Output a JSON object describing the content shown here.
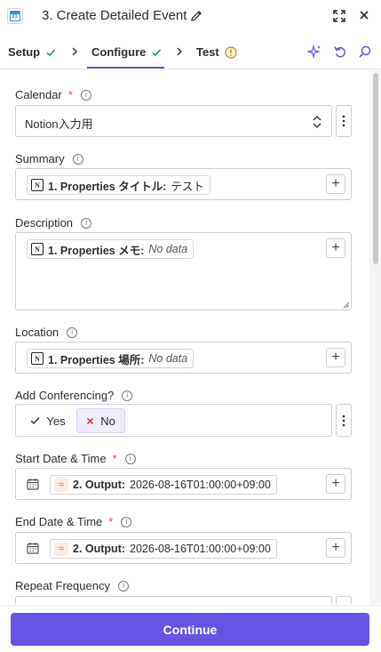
{
  "header": {
    "title": "3. Create Detailed Event",
    "app_icon_text": "31",
    "icons": [
      "calendar-app-icon",
      "pencil-icon",
      "expand-icon",
      "close-icon"
    ]
  },
  "tabs": [
    {
      "label": "Setup",
      "status": "check"
    },
    {
      "label": "Configure",
      "status": "check",
      "active": true
    },
    {
      "label": "Test",
      "status": "warning"
    }
  ],
  "tab_tools": [
    "sparkle-icon",
    "undo-icon",
    "search-icon"
  ],
  "fields": {
    "calendar": {
      "label": "Calendar",
      "required": true,
      "value": "Notion入力用"
    },
    "summary": {
      "label": "Summary",
      "required": false,
      "pill_step": "1. Properties タイトル:",
      "pill_value": "テスト"
    },
    "description": {
      "label": "Description",
      "required": false,
      "pill_step": "1. Properties メモ:",
      "pill_value": "No data"
    },
    "location": {
      "label": "Location",
      "required": false,
      "pill_step": "1. Properties 場所:",
      "pill_value": "No data"
    },
    "conferencing": {
      "label": "Add Conferencing?",
      "required": false,
      "options": [
        "Yes",
        "No"
      ],
      "selected": "No"
    },
    "start": {
      "label": "Start Date & Time",
      "required": true,
      "pill_step": "2. Output:",
      "pill_value": "2026-08-16T01:00:00+09:00"
    },
    "end": {
      "label": "End Date & Time",
      "required": true,
      "pill_step": "2. Output:",
      "pill_value": "2026-08-16T01:00:00+09:00"
    },
    "repeat": {
      "label": "Repeat Frequency",
      "required": false
    }
  },
  "footer": {
    "continue_label": "Continue"
  },
  "colors": {
    "accent": "#6653e6",
    "required": "#e0533d",
    "check": "#1b8a5a",
    "warning": "#b88a00"
  }
}
